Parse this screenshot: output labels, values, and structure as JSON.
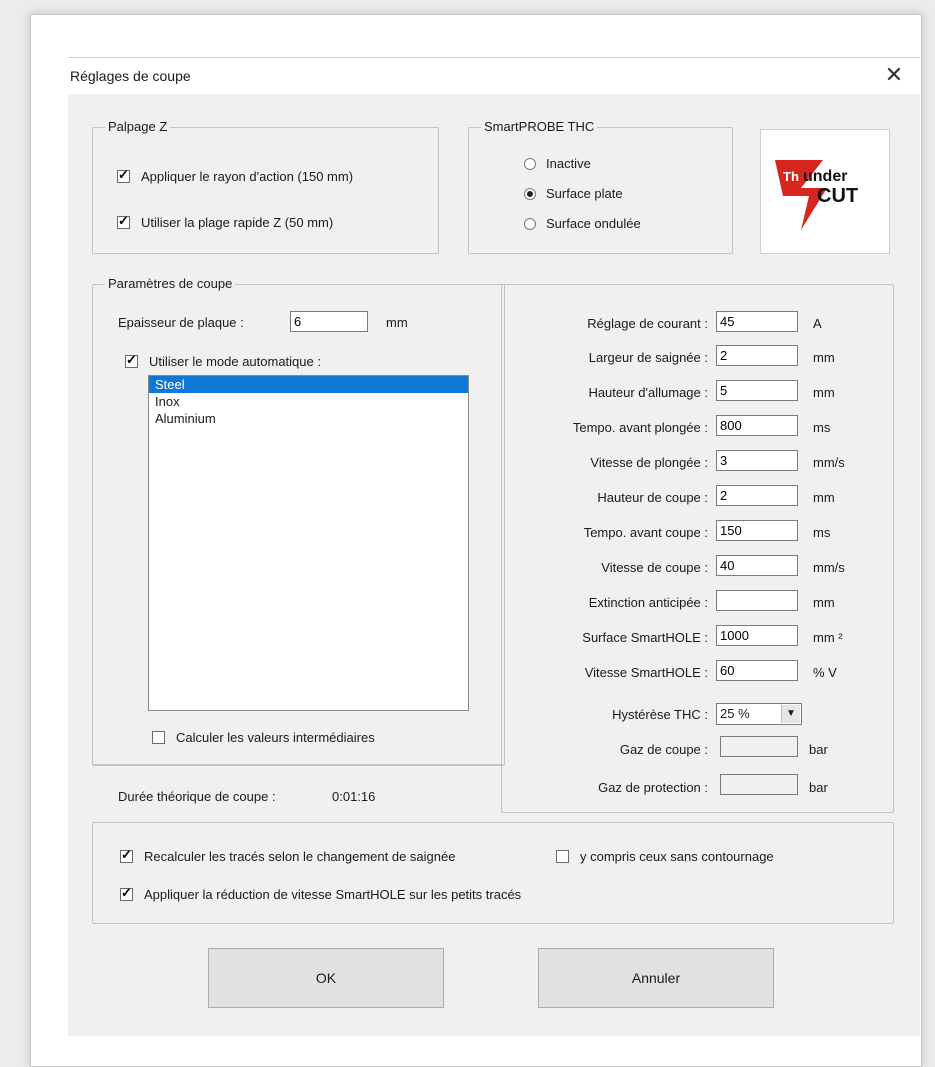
{
  "dialog": {
    "title": "Réglages de coupe",
    "close": "✕"
  },
  "palpage": {
    "legend": "Palpage Z",
    "apply_radius": {
      "label": "Appliquer le rayon d'action  (150 mm)",
      "checked": true
    },
    "rapid_range": {
      "label": "Utiliser la plage rapide Z  (50 mm)",
      "checked": true
    }
  },
  "thc": {
    "legend": "SmartPROBE THC",
    "options": [
      {
        "label": "Inactive",
        "selected": false
      },
      {
        "label": "Surface plate",
        "selected": true
      },
      {
        "label": "Surface ondulée",
        "selected": false
      }
    ]
  },
  "logo": {
    "text_top": "Thunder",
    "text_bottom": "CUT",
    "accent": "#d7261e"
  },
  "params": {
    "legend": "Paramètres de coupe",
    "plate_label": "Epaisseur de plaque :",
    "plate_value": "6",
    "plate_unit": "mm",
    "auto_mode": {
      "label": "Utiliser le mode automatique :",
      "checked": true
    },
    "materials": [
      {
        "label": "Steel",
        "selected": true
      },
      {
        "label": "Inox",
        "selected": false
      },
      {
        "label": "Aluminium",
        "selected": false
      }
    ],
    "intermediate": {
      "label": "Calculer les valeurs intermédiaires",
      "checked": false
    },
    "duration_label": "Durée théorique de coupe :",
    "duration_value": "0:01:16"
  },
  "settings": [
    {
      "label": "Réglage de courant :",
      "value": "45",
      "unit": "A"
    },
    {
      "label": "Largeur de saignée :",
      "value": "2",
      "unit": "mm"
    },
    {
      "label": "Hauteur d'allumage :",
      "value": "5",
      "unit": "mm"
    },
    {
      "label": "Tempo. avant plongée :",
      "value": "800",
      "unit": "ms"
    },
    {
      "label": "Vitesse de plongée :",
      "value": "3",
      "unit": "mm/s"
    },
    {
      "label": "Hauteur de coupe :",
      "value": "2",
      "unit": "mm"
    },
    {
      "label": "Tempo. avant coupe :",
      "value": "150",
      "unit": "ms"
    },
    {
      "label": "Vitesse de coupe :",
      "value": "40",
      "unit": "mm/s"
    },
    {
      "label": "Extinction anticipée :",
      "value": "",
      "unit": "mm"
    },
    {
      "label": "Surface SmartHOLE :",
      "value": "1000",
      "unit": "mm ²"
    },
    {
      "label": "Vitesse SmartHOLE :",
      "value": "60",
      "unit": "% V"
    }
  ],
  "hysteresis": {
    "label": "Hystérèse THC :",
    "value": "25 %"
  },
  "gas": [
    {
      "label": "Gaz de coupe :",
      "value": "",
      "unit": "bar"
    },
    {
      "label": "Gaz de protection :",
      "value": "",
      "unit": "bar"
    }
  ],
  "bottom": {
    "recalc": {
      "label": "Recalculer les tracés selon le changement de saignée",
      "checked": true
    },
    "include": {
      "label": "y compris ceux sans contournage",
      "checked": false
    },
    "smarthole": {
      "label": "Appliquer la réduction de vitesse SmartHOLE sur les petits tracés",
      "checked": true
    }
  },
  "buttons": {
    "ok": "OK",
    "cancel": "Annuler"
  }
}
